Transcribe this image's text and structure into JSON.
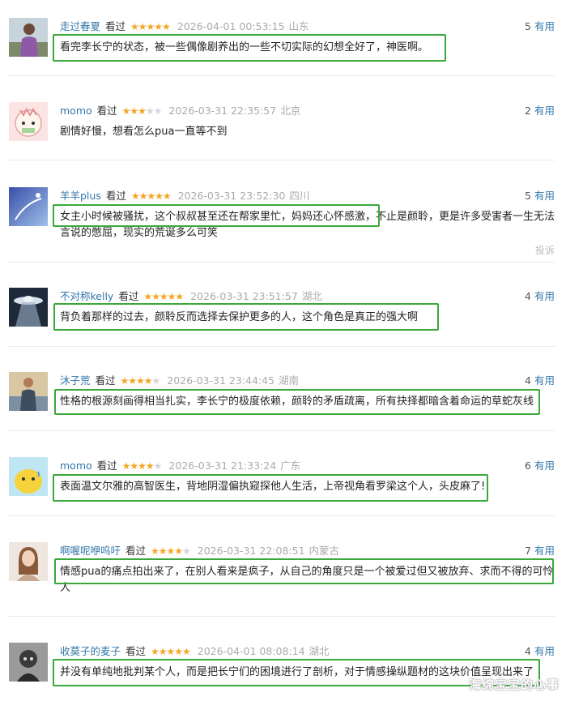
{
  "useful_label": "有用",
  "watched_label": "看过",
  "report_label": "投诉",
  "watermark": "海绵宝宝的心事",
  "colors": {
    "username": "#3377aa",
    "star": "#f5a623",
    "highlight_box": "#3aa83a"
  },
  "comments": [
    {
      "user": "走过春夏",
      "stars": 5,
      "time": "2026-04-01 00:53:15",
      "location": "山东",
      "useful": "5",
      "text": "看完李长宁的状态，被一些偶像剧养出的一些不切实际的幻想全好了，神医啊。",
      "avatar": "person-avatar"
    },
    {
      "user": "momo",
      "stars": 3,
      "time": "2026-03-31 22:35:57",
      "location": "北京",
      "useful": "2",
      "text": "剧情好慢，想看怎么pua一直等不到",
      "avatar": "cartoon-avatar"
    },
    {
      "user": "羊羊plus",
      "stars": 5,
      "time": "2026-03-31 23:52:30",
      "location": "四川",
      "useful": "5",
      "text": "女主小时候被骚扰，这个叔叔甚至还在帮家里忙，妈妈还心怀感激，不止是颜聆，更是许多受害者一生无法言说的憋屈，现实的荒诞多么可笑",
      "avatar": "sky-avatar"
    },
    {
      "user": "不对称kelly",
      "stars": 5,
      "time": "2026-03-31 23:51:57",
      "location": "湖北",
      "useful": "4",
      "text": "背负着那样的过去，颜聆反而选择去保护更多的人，这个角色是真正的强大啊",
      "avatar": "ufo-avatar"
    },
    {
      "user": "沐子荒",
      "stars": 4,
      "time": "2026-03-31 23:44:45",
      "location": "湖南",
      "useful": "4",
      "text": "性格的根源刻画得相当扎实，李长宁的极度依赖，颜聆的矛盾疏离，所有抉择都暗含着命运的草蛇灰线",
      "avatar": "person-avatar"
    },
    {
      "user": "momo",
      "stars": 4,
      "time": "2026-03-31 21:33:24",
      "location": "广东",
      "useful": "6",
      "text": "表面温文尔雅的高智医生，背地阴湿偏执窥探他人生活，上帝视角看罗梁这个人，头皮麻了!",
      "avatar": "cartoon-avatar"
    },
    {
      "user": "啊喔呢咿呜吁",
      "stars": 4,
      "time": "2026-03-31 22:08:51",
      "location": "内蒙古",
      "useful": "7",
      "text": "情感pua的痛点拍出来了，在别人看来是疯子，从自己的角度只是一个被爱过但又被放弃、求而不得的可怜人",
      "avatar": "person-avatar"
    },
    {
      "user": "收莫子的麦子",
      "stars": 5,
      "time": "2026-04-01 08:08:14",
      "location": "湖北",
      "useful": "4",
      "text": "并没有单纯地批判某个人，而是把长宁们的困境进行了剖析，对于情感操纵题材的这块价值呈现出来了",
      "avatar": "person-avatar"
    }
  ]
}
